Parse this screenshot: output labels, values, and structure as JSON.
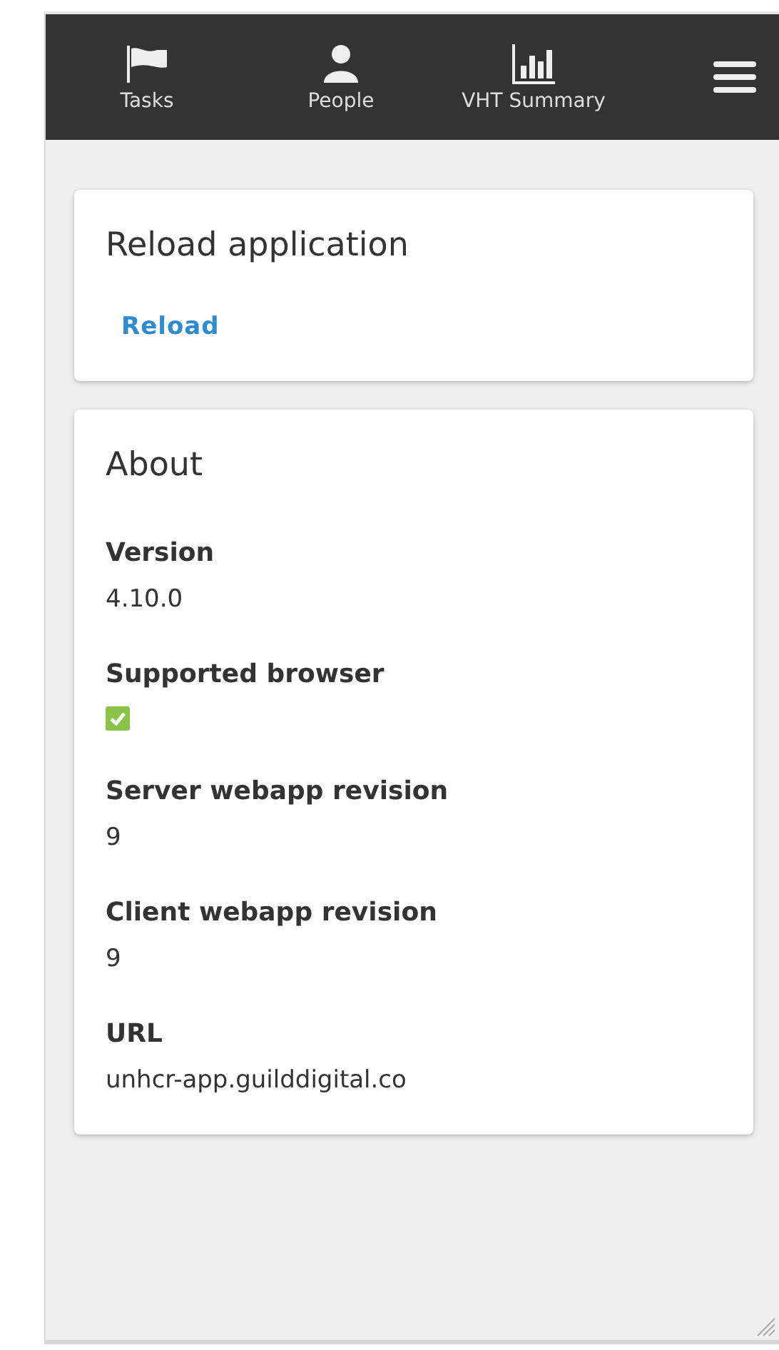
{
  "nav": {
    "items": [
      {
        "label": "Tasks",
        "kind": "flag"
      },
      {
        "label": "People",
        "kind": "person"
      },
      {
        "label": "VHT Summary",
        "kind": "chart"
      }
    ]
  },
  "reload_card": {
    "title": "Reload application",
    "link": "Reload"
  },
  "about_card": {
    "title": "About",
    "fields": [
      {
        "label": "Version",
        "kind": "text",
        "value": "4.10.0"
      },
      {
        "label": "Supported browser",
        "kind": "check",
        "checked": true
      },
      {
        "label": "Server webapp revision",
        "kind": "text",
        "value": "9"
      },
      {
        "label": "Client webapp revision",
        "kind": "text",
        "value": "9"
      },
      {
        "label": "URL",
        "kind": "text",
        "value": "unhcr-app.guilddigital.co"
      }
    ]
  }
}
